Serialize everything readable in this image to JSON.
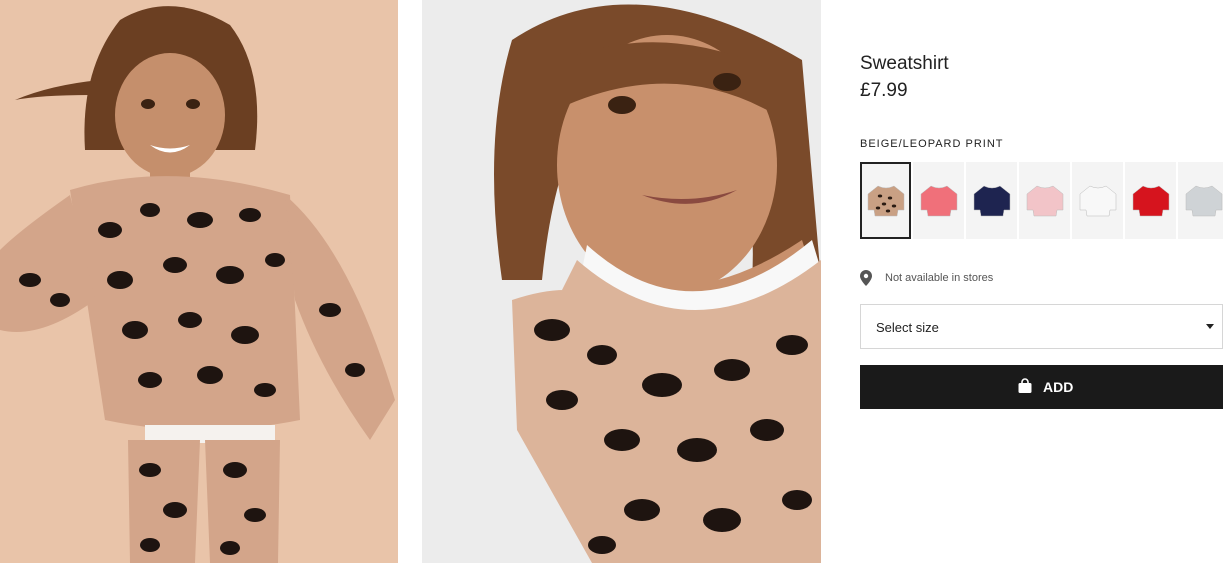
{
  "product": {
    "name": "Sweatshirt",
    "price": "£7.99",
    "color_label": "BEIGE/LEOPARD PRINT"
  },
  "swatches": [
    {
      "name": "beige-leopard",
      "color": "#c9a084",
      "selected": true
    },
    {
      "name": "pink",
      "color": "#f0707a",
      "selected": false
    },
    {
      "name": "navy",
      "color": "#1e2450",
      "selected": false
    },
    {
      "name": "light-pink",
      "color": "#f2c4c8",
      "selected": false
    },
    {
      "name": "white",
      "color": "#f8f8f8",
      "selected": false
    },
    {
      "name": "red",
      "color": "#d6141e",
      "selected": false
    },
    {
      "name": "grey",
      "color": "#cfd3d6",
      "selected": false
    }
  ],
  "availability": {
    "text": "Not available in stores",
    "icon": "location-pin-icon"
  },
  "size_select": {
    "label": "Select size",
    "icon": "chevron-down-icon"
  },
  "add_button": {
    "label": "ADD",
    "icon": "shopping-bag-icon"
  },
  "colors": {
    "primary_button": "#1a1a1a",
    "photo1_bg": "#e9c4a9",
    "photo2_bg": "#ececec"
  }
}
